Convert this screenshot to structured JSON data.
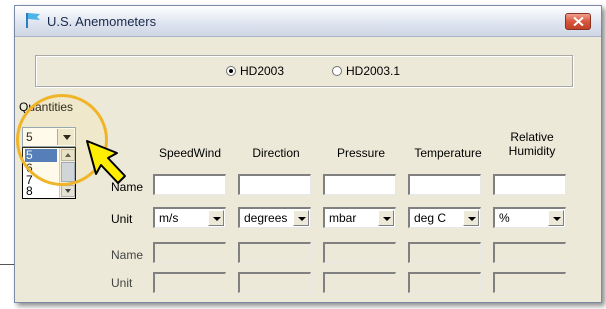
{
  "window": {
    "title": "U.S. Anemometers"
  },
  "instrument_options": [
    {
      "label": "HD2003",
      "selected": true
    },
    {
      "label": "HD2003.1",
      "selected": false
    }
  ],
  "quantities": {
    "label": "Quantities",
    "selected_value": "5",
    "options": [
      "5",
      "6",
      "7",
      "8"
    ]
  },
  "columns": [
    {
      "header": "SpeedWind"
    },
    {
      "header": "Direction"
    },
    {
      "header": "Pressure"
    },
    {
      "header": "Temperature"
    },
    {
      "header": "Relative\nHumidity"
    }
  ],
  "rows": {
    "name_label": "Name",
    "unit_label": "Unit",
    "units": [
      "m/s",
      "degrees",
      "mbar",
      "deg C",
      "%"
    ]
  },
  "colors": {
    "highlight_ring": "#f0b429",
    "pointer": "#ffee00",
    "selection": "#316ac5",
    "close_button": "#d8553a"
  },
  "icons": {
    "app": "flag-icon",
    "close": "close-icon",
    "pointer": "mouse-pointer-icon"
  }
}
